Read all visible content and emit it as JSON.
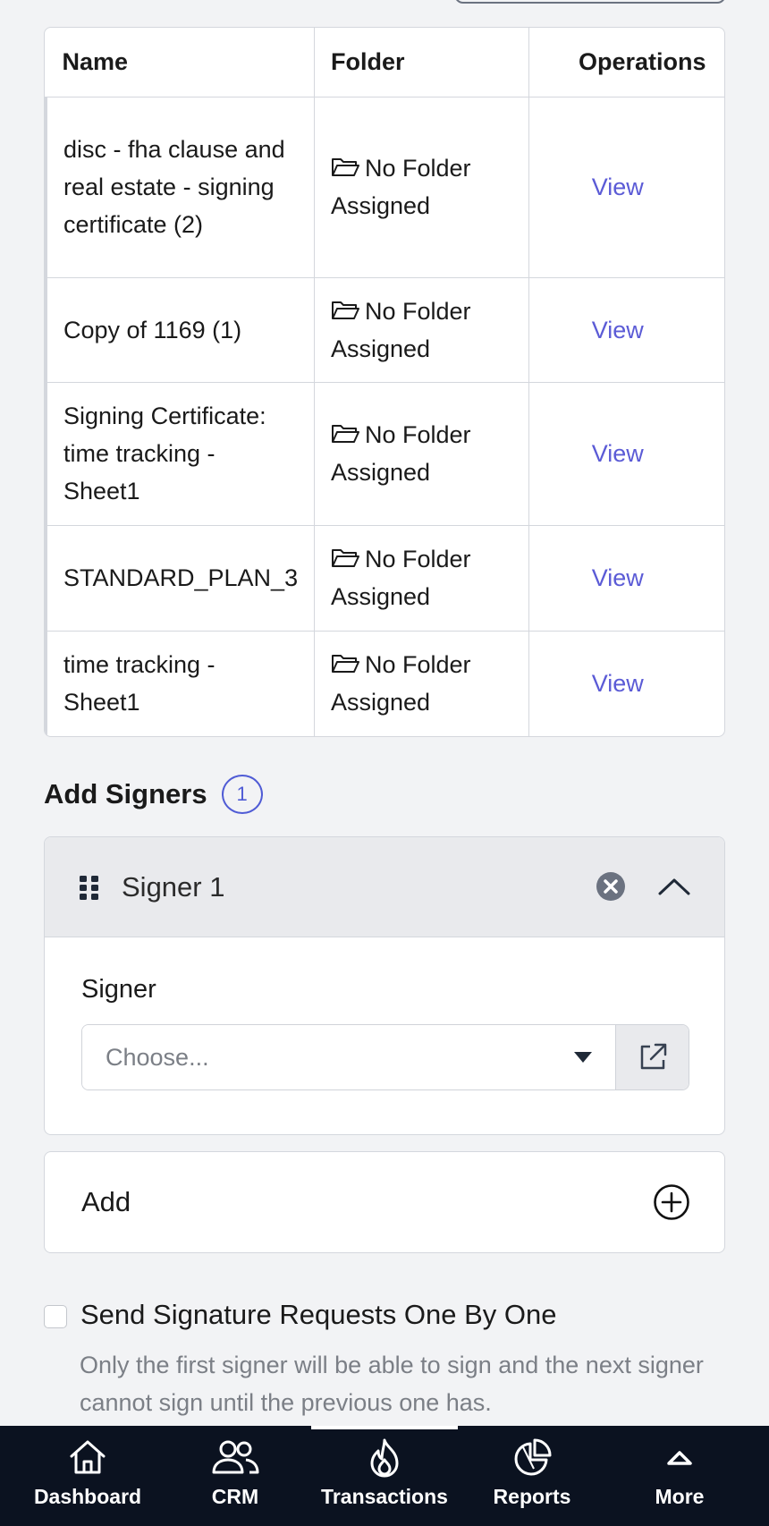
{
  "documents": {
    "headers": {
      "name": "Name",
      "folder": "Folder",
      "operations": "Operations"
    },
    "rows": [
      {
        "name": "disc - fha clause and real estate - signing certificate (2)",
        "folder": "No Folder Assigned",
        "action": "View"
      },
      {
        "name": "Copy of 1169 (1)",
        "folder": "No Folder Assigned",
        "action": "View"
      },
      {
        "name": "Signing Certificate: time tracking - Sheet1",
        "folder": "No Folder Assigned",
        "action": "View"
      },
      {
        "name": "STANDARD_PLAN_3",
        "folder": "No Folder Assigned",
        "action": "View"
      },
      {
        "name": "time tracking - Sheet1",
        "folder": "No Folder Assigned",
        "action": "View"
      }
    ]
  },
  "signers": {
    "heading": "Add Signers",
    "count": "1",
    "items": [
      {
        "title": "Signer 1",
        "field_label": "Signer",
        "select_placeholder": "Choose..."
      }
    ],
    "add_label": "Add"
  },
  "sequential": {
    "label": "Send Signature Requests One By One",
    "help": "Only the first signer will be able to sign and the next signer cannot sign until the previous one has.",
    "checked": false
  },
  "nav": {
    "items": [
      {
        "label": "Dashboard",
        "icon": "home-icon"
      },
      {
        "label": "CRM",
        "icon": "users-icon"
      },
      {
        "label": "Transactions",
        "icon": "flame-icon"
      },
      {
        "label": "Reports",
        "icon": "pie-chart-icon"
      },
      {
        "label": "More",
        "icon": "chevron-up-icon"
      }
    ],
    "active_index": 2
  },
  "colors": {
    "link": "#5b5bd6",
    "badge": "#4f5bd5",
    "nav_bg": "#0b1220"
  }
}
